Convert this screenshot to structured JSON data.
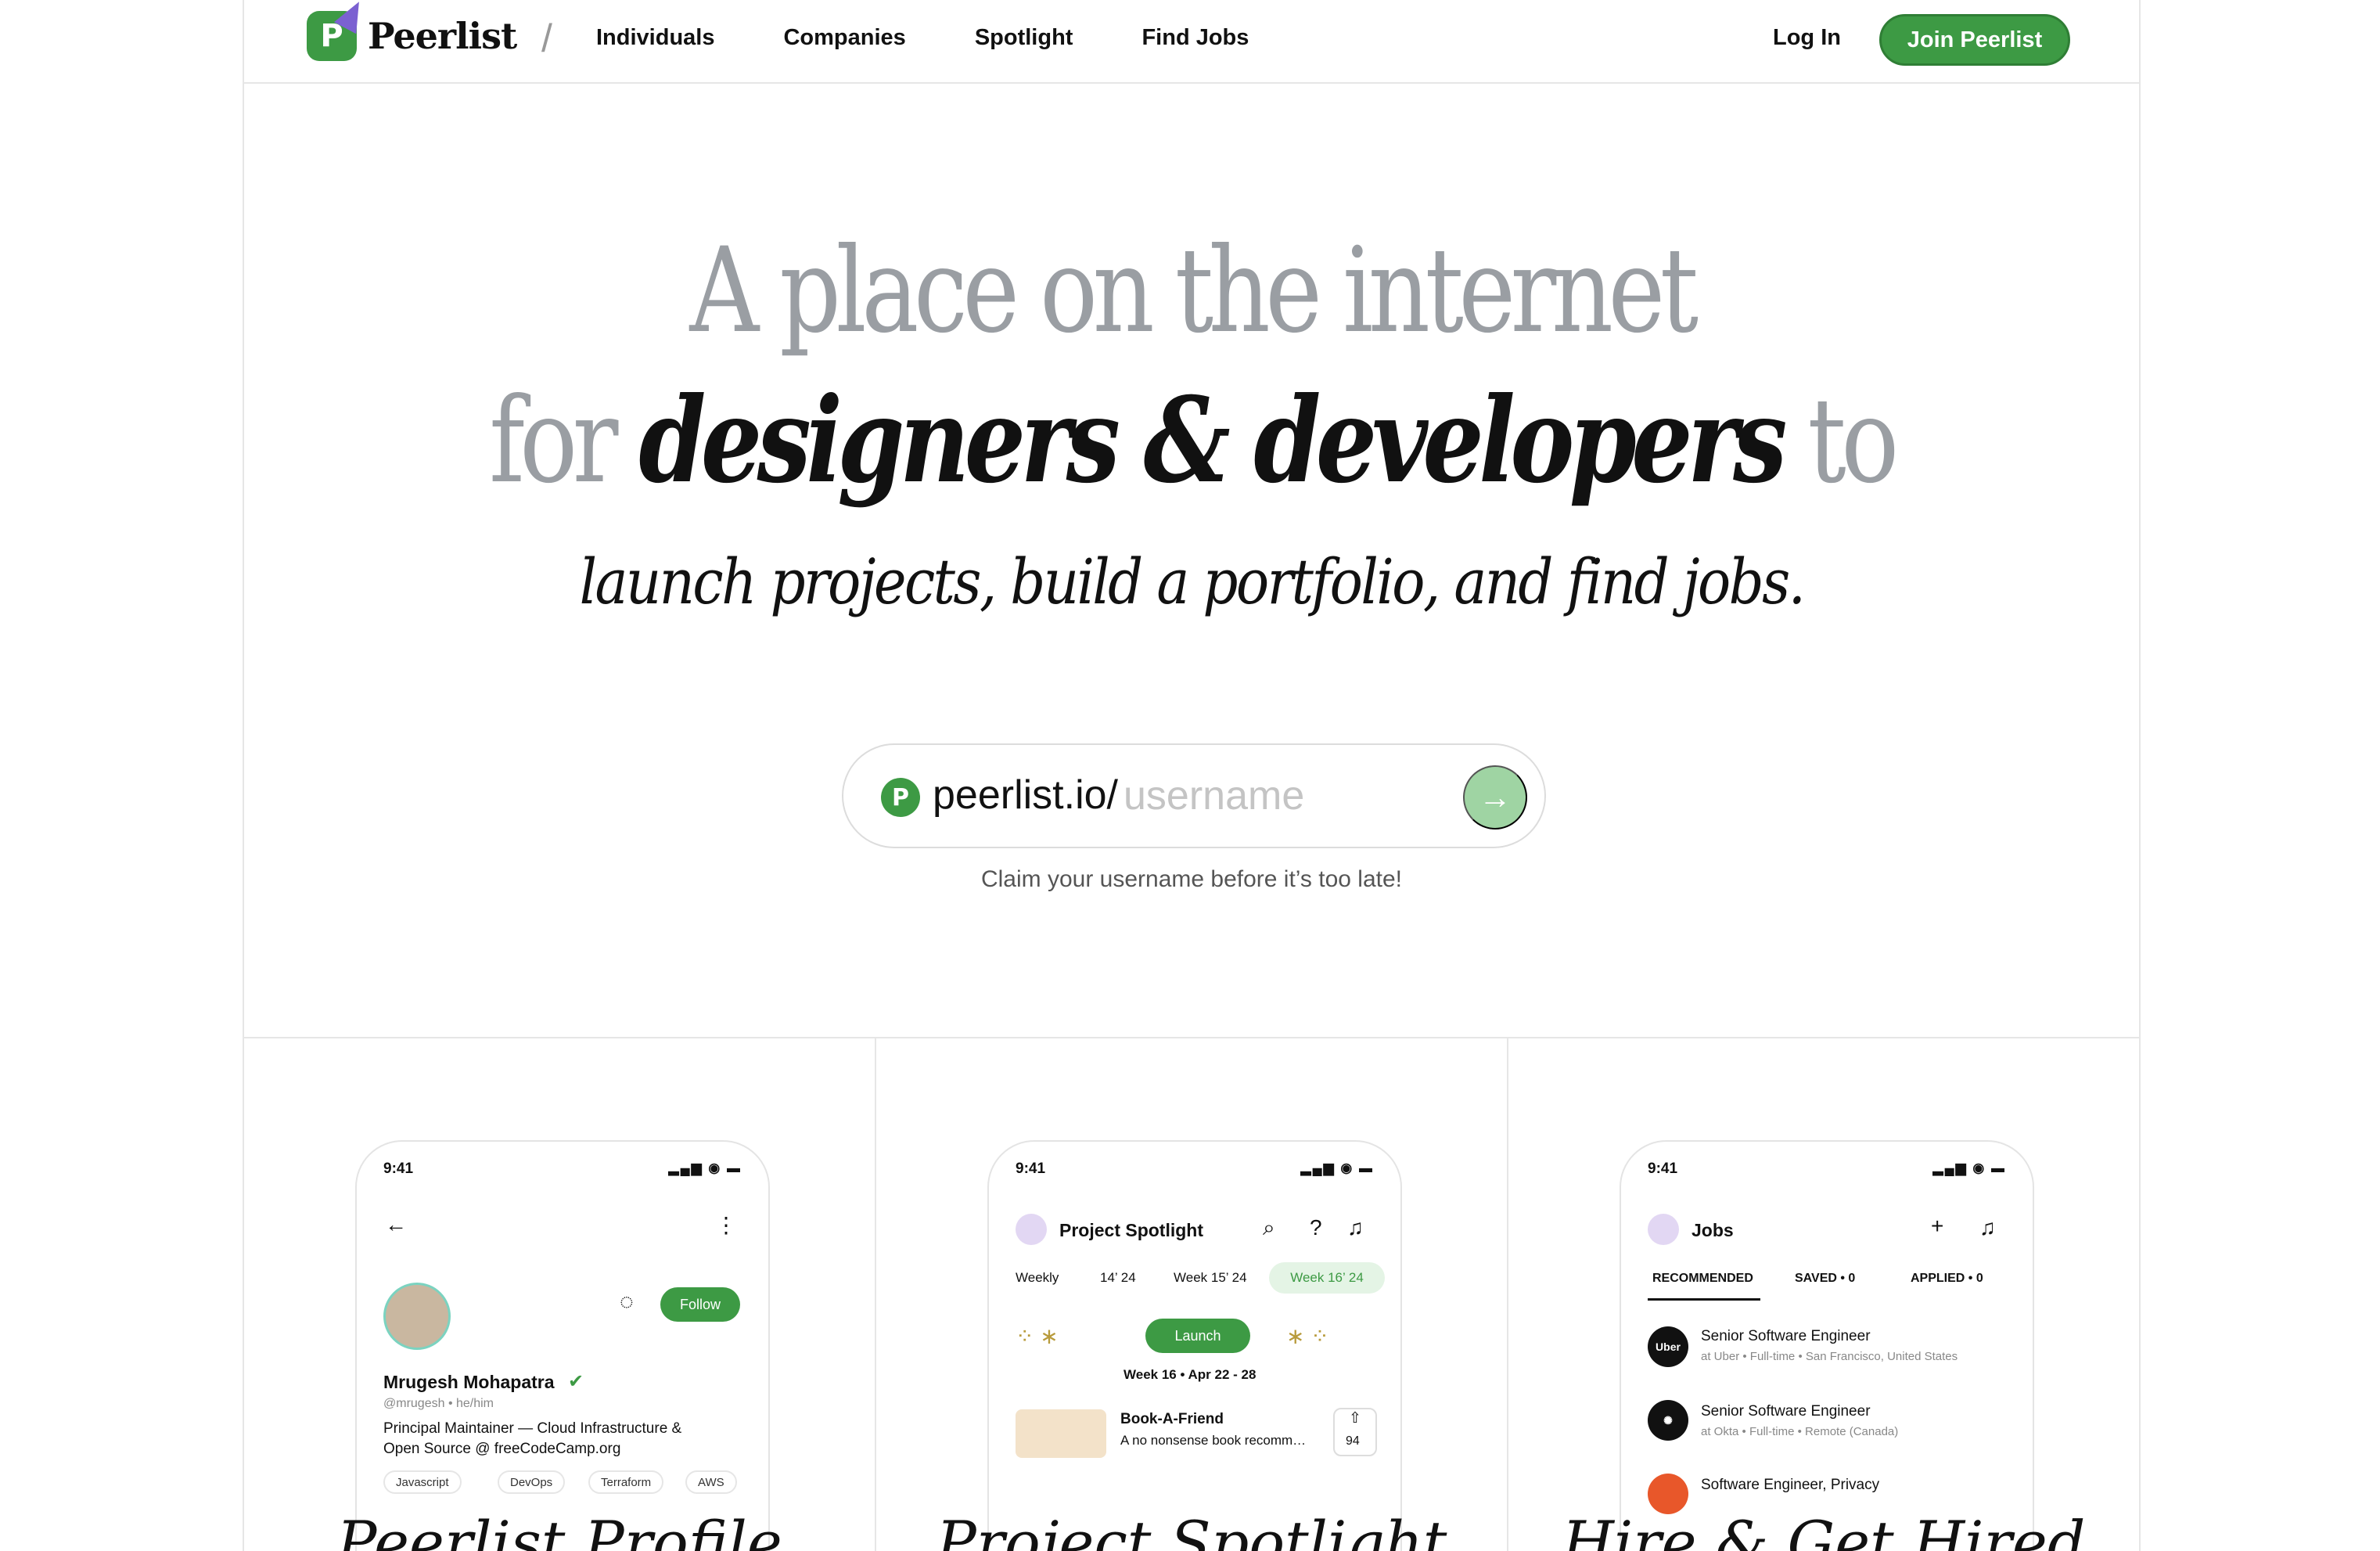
{
  "nav": {
    "brand": "Peerlist",
    "logo_letter": "P",
    "links": [
      "Individuals",
      "Companies",
      "Spotlight",
      "Find Jobs"
    ],
    "login": "Log In",
    "join": "Join Peerlist"
  },
  "hero": {
    "line1": "A place on the internet",
    "line2_pre": "for ",
    "line2_em": "designers & developers",
    "line2_post": " to",
    "line3": "launch projects, build a portfolio, and find jobs.",
    "claim_domain": "peerlist.io/",
    "claim_placeholder": "username",
    "claim_note": "Claim your username before it’s too late!"
  },
  "cards": [
    {
      "time": "9:41",
      "profile_name": "Mrugesh Mohapatra",
      "handle": "@mrugesh • he/him",
      "bio_line1": "Principal Maintainer — Cloud Infrastructure &",
      "bio_line2": "Open Source @ freeCodeCamp.org",
      "follow": "Follow",
      "tags": [
        "Javascript",
        "DevOps",
        "Terraform",
        "AWS"
      ],
      "title": "Peerlist Profile"
    },
    {
      "time": "9:41",
      "header": "Project Spotlight",
      "weeks": [
        "Weekly",
        "14’ 24",
        "Week 15’ 24",
        "Week 16’ 24"
      ],
      "launch": "Launch",
      "week_range": "Week 16 • Apr 22 - 28",
      "project_name": "Book-A-Friend",
      "project_desc": "A no nonsense book recomm…",
      "upvotes": "94",
      "title": "Project Spotlight"
    },
    {
      "time": "9:41",
      "header": "Jobs",
      "tabs": [
        "RECOMMENDED",
        "SAVED • 0",
        "APPLIED • 0"
      ],
      "jobs": [
        {
          "logo": "Uber",
          "title": "Senior Software Engineer",
          "meta": "at Uber • Full-time • San Francisco, United States"
        },
        {
          "logo": "",
          "title": "Senior Software Engineer",
          "meta": "at Okta • Full-time • Remote (Canada)"
        },
        {
          "logo": "",
          "title": "Software Engineer, Privacy",
          "meta": ""
        }
      ],
      "title": "Hire & Get Hired"
    }
  ],
  "colors": {
    "brand_green": "#3d9a44",
    "muted_grey": "#9a9ea3"
  }
}
